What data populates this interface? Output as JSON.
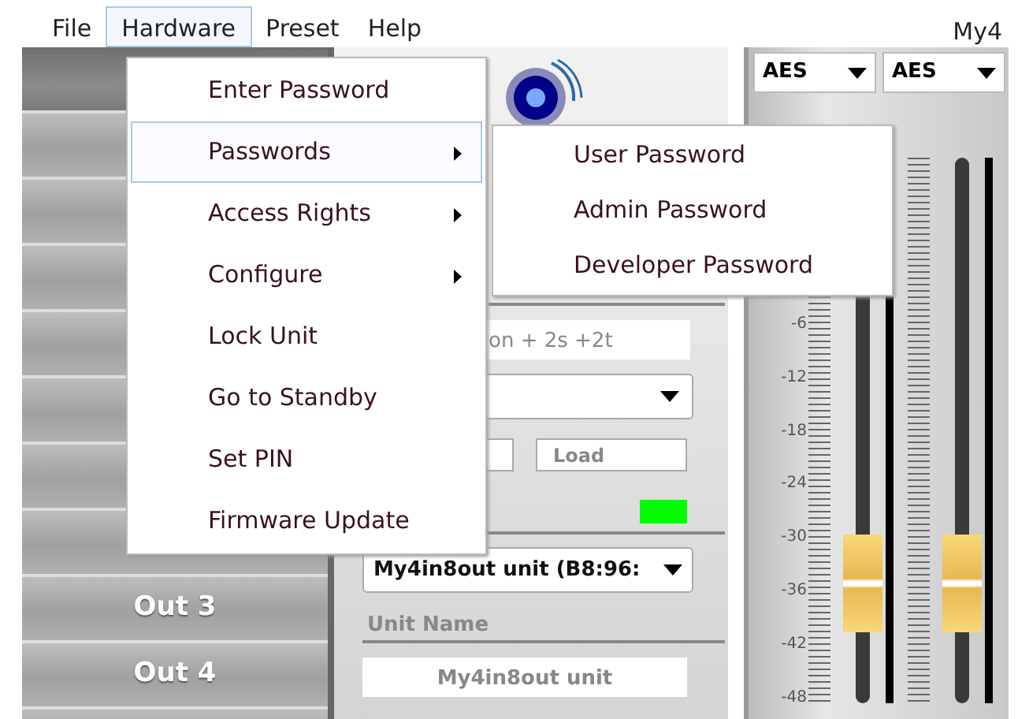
{
  "menubar": [
    {
      "label": "File",
      "selected": false
    },
    {
      "label": "Hardware",
      "selected": true
    },
    {
      "label": "Preset",
      "selected": false
    },
    {
      "label": "Help",
      "selected": false
    }
  ],
  "device_title": "My4",
  "sidebar": {
    "items": [
      {
        "selected": true
      },
      {
        "selected": false
      },
      {
        "selected": false
      },
      {
        "selected": false
      },
      {
        "selected": false
      },
      {
        "selected": false
      },
      {
        "selected": false
      },
      {
        "selected": false
      },
      {
        "label": "Out 3",
        "selected": false
      },
      {
        "label": "Out 4",
        "selected": false
      },
      {
        "selected": false
      }
    ]
  },
  "settings": {
    "preset_field": {
      "value": "on + 2s +2t"
    },
    "load_button": "Load",
    "status_indicator": {
      "on": true
    },
    "unit_select": {
      "value": "My4in8out unit (B8:96:"
    },
    "unit_name_label": "Unit Name",
    "unit_name_field": {
      "value": "My4in8out unit"
    }
  },
  "mixer": {
    "input_selects": [
      {
        "value": "AES"
      },
      {
        "value": "AES"
      }
    ],
    "scale": [
      "-6",
      "-12",
      "-18",
      "-24",
      "-30",
      "-36",
      "-42",
      "-48"
    ],
    "faders": [
      {
        "level": 0.22
      },
      {
        "level": 0.22
      }
    ]
  },
  "hardware_menu": {
    "items": [
      {
        "label": "Enter Password",
        "submenu": false,
        "selected": false
      },
      {
        "label": "Passwords",
        "submenu": true,
        "selected": true
      },
      {
        "label": "Access Rights",
        "submenu": true,
        "selected": false
      },
      {
        "label": "Configure",
        "submenu": true,
        "selected": false
      },
      {
        "label": "Lock Unit",
        "submenu": false,
        "selected": false
      },
      {
        "label": "Go to Standby",
        "submenu": false,
        "selected": false
      },
      {
        "label": "Set PIN",
        "submenu": false,
        "selected": false
      },
      {
        "label": "Firmware Update",
        "submenu": false,
        "selected": false
      }
    ]
  },
  "passwords_submenu": {
    "items": [
      {
        "label": "User Password",
        "selected": false
      },
      {
        "label": "Admin Password",
        "selected": false
      },
      {
        "label": "Developer Password",
        "selected": false
      }
    ]
  }
}
